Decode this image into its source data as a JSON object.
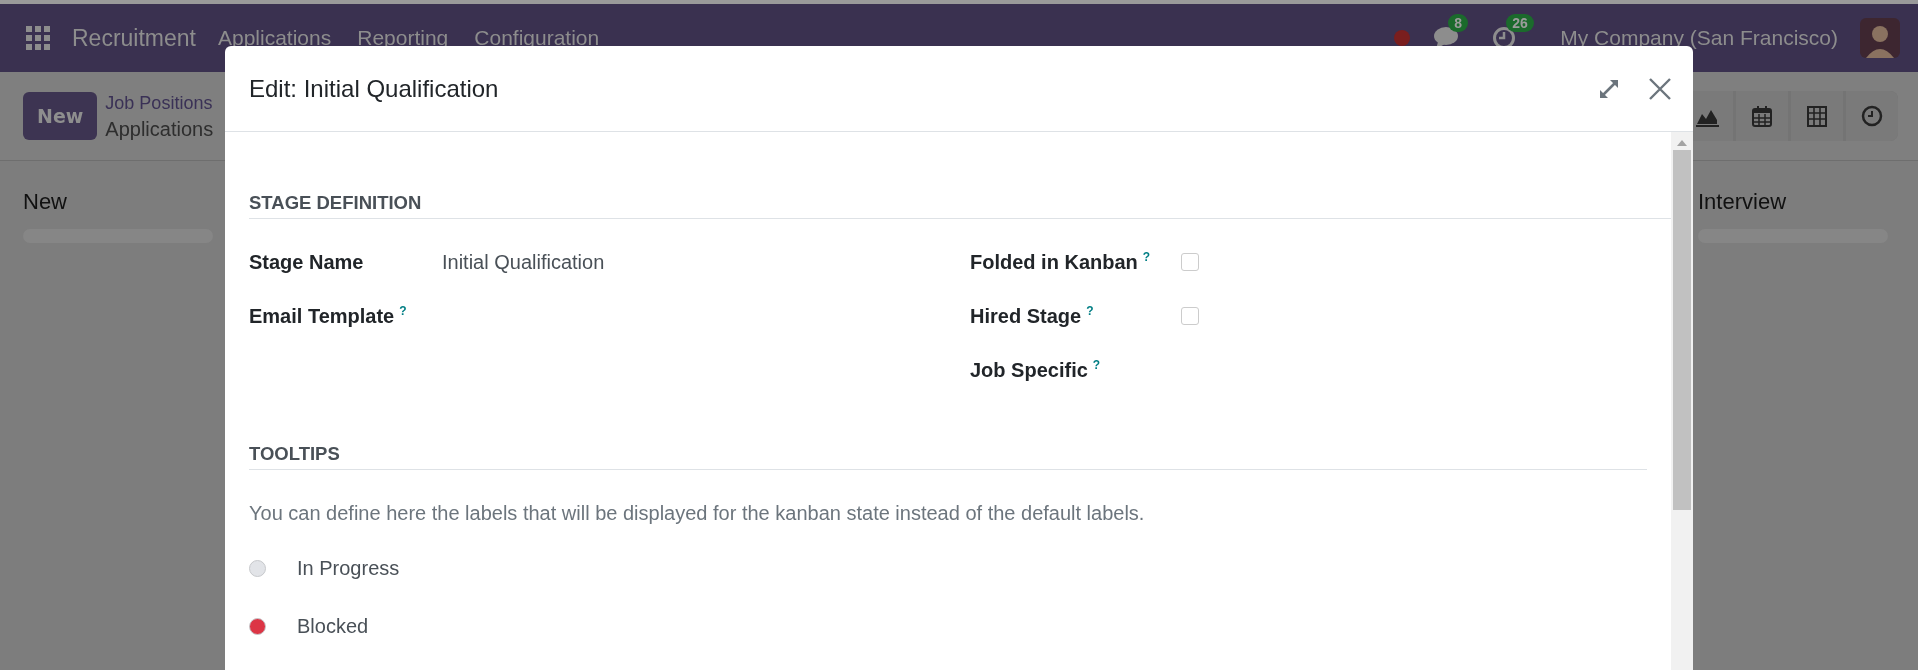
{
  "navbar": {
    "app_name": "Recruitment",
    "menu": [
      "Applications",
      "Reporting",
      "Configuration"
    ],
    "message_count": "8",
    "activity_count": "26",
    "company": "My Company (San Francisco)"
  },
  "control_panel": {
    "new_button": "New",
    "breadcrumb": [
      "Job Positions",
      "Applications"
    ],
    "views": [
      {
        "kind": "graph"
      },
      {
        "kind": "calendar"
      },
      {
        "kind": "pivot"
      },
      {
        "kind": "activity"
      }
    ]
  },
  "kanban_columns": [
    "New",
    "Interview"
  ],
  "dialog": {
    "title": "Edit: Initial Qualification",
    "stage_definition": {
      "title": "STAGE DEFINITION",
      "left_fields": [
        {
          "label": "Stage Name",
          "value": "Initial Qualification"
        },
        {
          "label": "Email Template",
          "help": "?"
        }
      ],
      "right_fields": [
        {
          "kind": "checkbox",
          "label": "Folded in Kanban",
          "help": "?",
          "checked": false
        },
        {
          "kind": "checkbox",
          "label": "Hired Stage",
          "help": "?",
          "checked": false
        },
        {
          "kind": "text",
          "label": "Job Specific",
          "help": "?"
        }
      ]
    },
    "tooltips": {
      "title": "TOOLTIPS",
      "note": "You can define here the labels that will be displayed for the kanban state instead of the default labels.",
      "states": [
        {
          "label": "In Progress",
          "color": "#e2e4e8"
        },
        {
          "label": "Blocked",
          "color": "#dc3545"
        }
      ]
    }
  }
}
